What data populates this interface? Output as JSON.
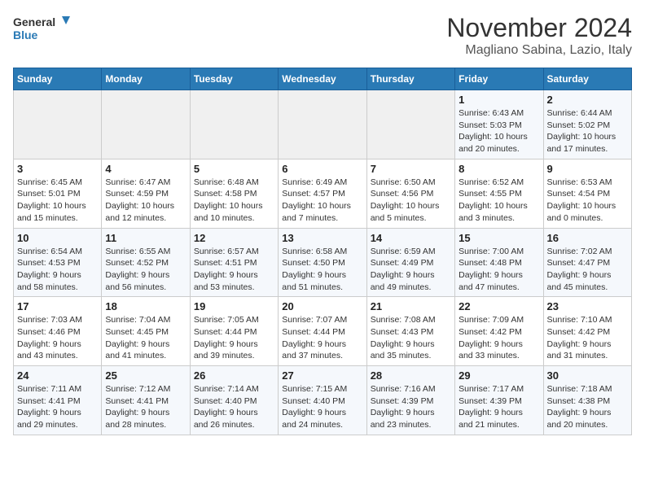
{
  "header": {
    "logo_line1": "General",
    "logo_line2": "Blue",
    "month_title": "November 2024",
    "location": "Magliano Sabina, Lazio, Italy"
  },
  "weekdays": [
    "Sunday",
    "Monday",
    "Tuesday",
    "Wednesday",
    "Thursday",
    "Friday",
    "Saturday"
  ],
  "weeks": [
    [
      {
        "day": "",
        "info": ""
      },
      {
        "day": "",
        "info": ""
      },
      {
        "day": "",
        "info": ""
      },
      {
        "day": "",
        "info": ""
      },
      {
        "day": "",
        "info": ""
      },
      {
        "day": "1",
        "info": "Sunrise: 6:43 AM\nSunset: 5:03 PM\nDaylight: 10 hours\nand 20 minutes."
      },
      {
        "day": "2",
        "info": "Sunrise: 6:44 AM\nSunset: 5:02 PM\nDaylight: 10 hours\nand 17 minutes."
      }
    ],
    [
      {
        "day": "3",
        "info": "Sunrise: 6:45 AM\nSunset: 5:01 PM\nDaylight: 10 hours\nand 15 minutes."
      },
      {
        "day": "4",
        "info": "Sunrise: 6:47 AM\nSunset: 4:59 PM\nDaylight: 10 hours\nand 12 minutes."
      },
      {
        "day": "5",
        "info": "Sunrise: 6:48 AM\nSunset: 4:58 PM\nDaylight: 10 hours\nand 10 minutes."
      },
      {
        "day": "6",
        "info": "Sunrise: 6:49 AM\nSunset: 4:57 PM\nDaylight: 10 hours\nand 7 minutes."
      },
      {
        "day": "7",
        "info": "Sunrise: 6:50 AM\nSunset: 4:56 PM\nDaylight: 10 hours\nand 5 minutes."
      },
      {
        "day": "8",
        "info": "Sunrise: 6:52 AM\nSunset: 4:55 PM\nDaylight: 10 hours\nand 3 minutes."
      },
      {
        "day": "9",
        "info": "Sunrise: 6:53 AM\nSunset: 4:54 PM\nDaylight: 10 hours\nand 0 minutes."
      }
    ],
    [
      {
        "day": "10",
        "info": "Sunrise: 6:54 AM\nSunset: 4:53 PM\nDaylight: 9 hours\nand 58 minutes."
      },
      {
        "day": "11",
        "info": "Sunrise: 6:55 AM\nSunset: 4:52 PM\nDaylight: 9 hours\nand 56 minutes."
      },
      {
        "day": "12",
        "info": "Sunrise: 6:57 AM\nSunset: 4:51 PM\nDaylight: 9 hours\nand 53 minutes."
      },
      {
        "day": "13",
        "info": "Sunrise: 6:58 AM\nSunset: 4:50 PM\nDaylight: 9 hours\nand 51 minutes."
      },
      {
        "day": "14",
        "info": "Sunrise: 6:59 AM\nSunset: 4:49 PM\nDaylight: 9 hours\nand 49 minutes."
      },
      {
        "day": "15",
        "info": "Sunrise: 7:00 AM\nSunset: 4:48 PM\nDaylight: 9 hours\nand 47 minutes."
      },
      {
        "day": "16",
        "info": "Sunrise: 7:02 AM\nSunset: 4:47 PM\nDaylight: 9 hours\nand 45 minutes."
      }
    ],
    [
      {
        "day": "17",
        "info": "Sunrise: 7:03 AM\nSunset: 4:46 PM\nDaylight: 9 hours\nand 43 minutes."
      },
      {
        "day": "18",
        "info": "Sunrise: 7:04 AM\nSunset: 4:45 PM\nDaylight: 9 hours\nand 41 minutes."
      },
      {
        "day": "19",
        "info": "Sunrise: 7:05 AM\nSunset: 4:44 PM\nDaylight: 9 hours\nand 39 minutes."
      },
      {
        "day": "20",
        "info": "Sunrise: 7:07 AM\nSunset: 4:44 PM\nDaylight: 9 hours\nand 37 minutes."
      },
      {
        "day": "21",
        "info": "Sunrise: 7:08 AM\nSunset: 4:43 PM\nDaylight: 9 hours\nand 35 minutes."
      },
      {
        "day": "22",
        "info": "Sunrise: 7:09 AM\nSunset: 4:42 PM\nDaylight: 9 hours\nand 33 minutes."
      },
      {
        "day": "23",
        "info": "Sunrise: 7:10 AM\nSunset: 4:42 PM\nDaylight: 9 hours\nand 31 minutes."
      }
    ],
    [
      {
        "day": "24",
        "info": "Sunrise: 7:11 AM\nSunset: 4:41 PM\nDaylight: 9 hours\nand 29 minutes."
      },
      {
        "day": "25",
        "info": "Sunrise: 7:12 AM\nSunset: 4:41 PM\nDaylight: 9 hours\nand 28 minutes."
      },
      {
        "day": "26",
        "info": "Sunrise: 7:14 AM\nSunset: 4:40 PM\nDaylight: 9 hours\nand 26 minutes."
      },
      {
        "day": "27",
        "info": "Sunrise: 7:15 AM\nSunset: 4:40 PM\nDaylight: 9 hours\nand 24 minutes."
      },
      {
        "day": "28",
        "info": "Sunrise: 7:16 AM\nSunset: 4:39 PM\nDaylight: 9 hours\nand 23 minutes."
      },
      {
        "day": "29",
        "info": "Sunrise: 7:17 AM\nSunset: 4:39 PM\nDaylight: 9 hours\nand 21 minutes."
      },
      {
        "day": "30",
        "info": "Sunrise: 7:18 AM\nSunset: 4:38 PM\nDaylight: 9 hours\nand 20 minutes."
      }
    ]
  ]
}
